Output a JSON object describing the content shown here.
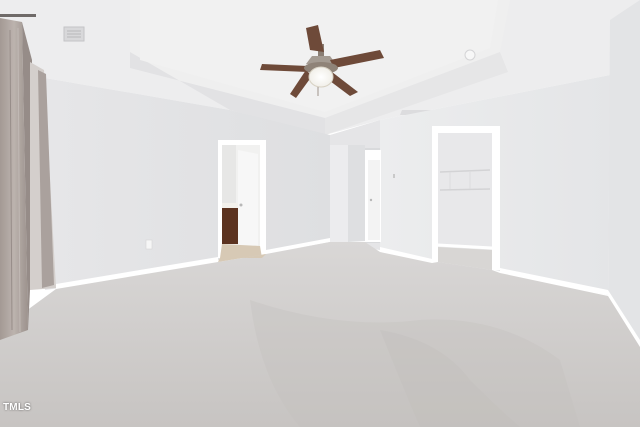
{
  "photo": {
    "subject": "empty-bedroom",
    "watermark": "TMLS",
    "colors": {
      "wall": "#e9e9ea",
      "ceiling": "#ececed",
      "carpet": "#cdcbca",
      "trim": "#ffffff",
      "curtain": "#b3aaa6",
      "fan_blade": "#6e4a39",
      "vanity": "#5c3320"
    }
  }
}
